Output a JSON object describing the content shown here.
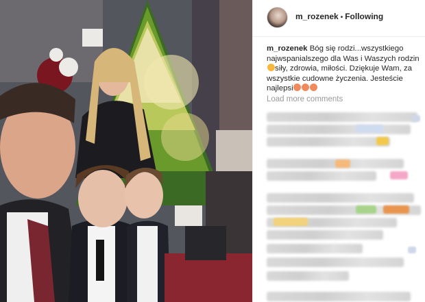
{
  "post": {
    "username": "m_rozenek",
    "separator": "•",
    "follow_status": "Following",
    "caption_user": "m_rozenek",
    "caption_text": "Bóg się rodzi...wszystkiego najwspanialszego dla Was i Waszych rodzin",
    "caption_text_2": "siły, zdrowia, miłości. Dziękuje Wam, za wszystkie cudowne życzenia. Jesteście najlepsi",
    "load_more": "Load more comments"
  },
  "colors": {
    "text": "#262626",
    "muted": "#999999",
    "divider": "#efefef"
  },
  "icons": [
    "avatar",
    "comment-bubble-icon"
  ]
}
